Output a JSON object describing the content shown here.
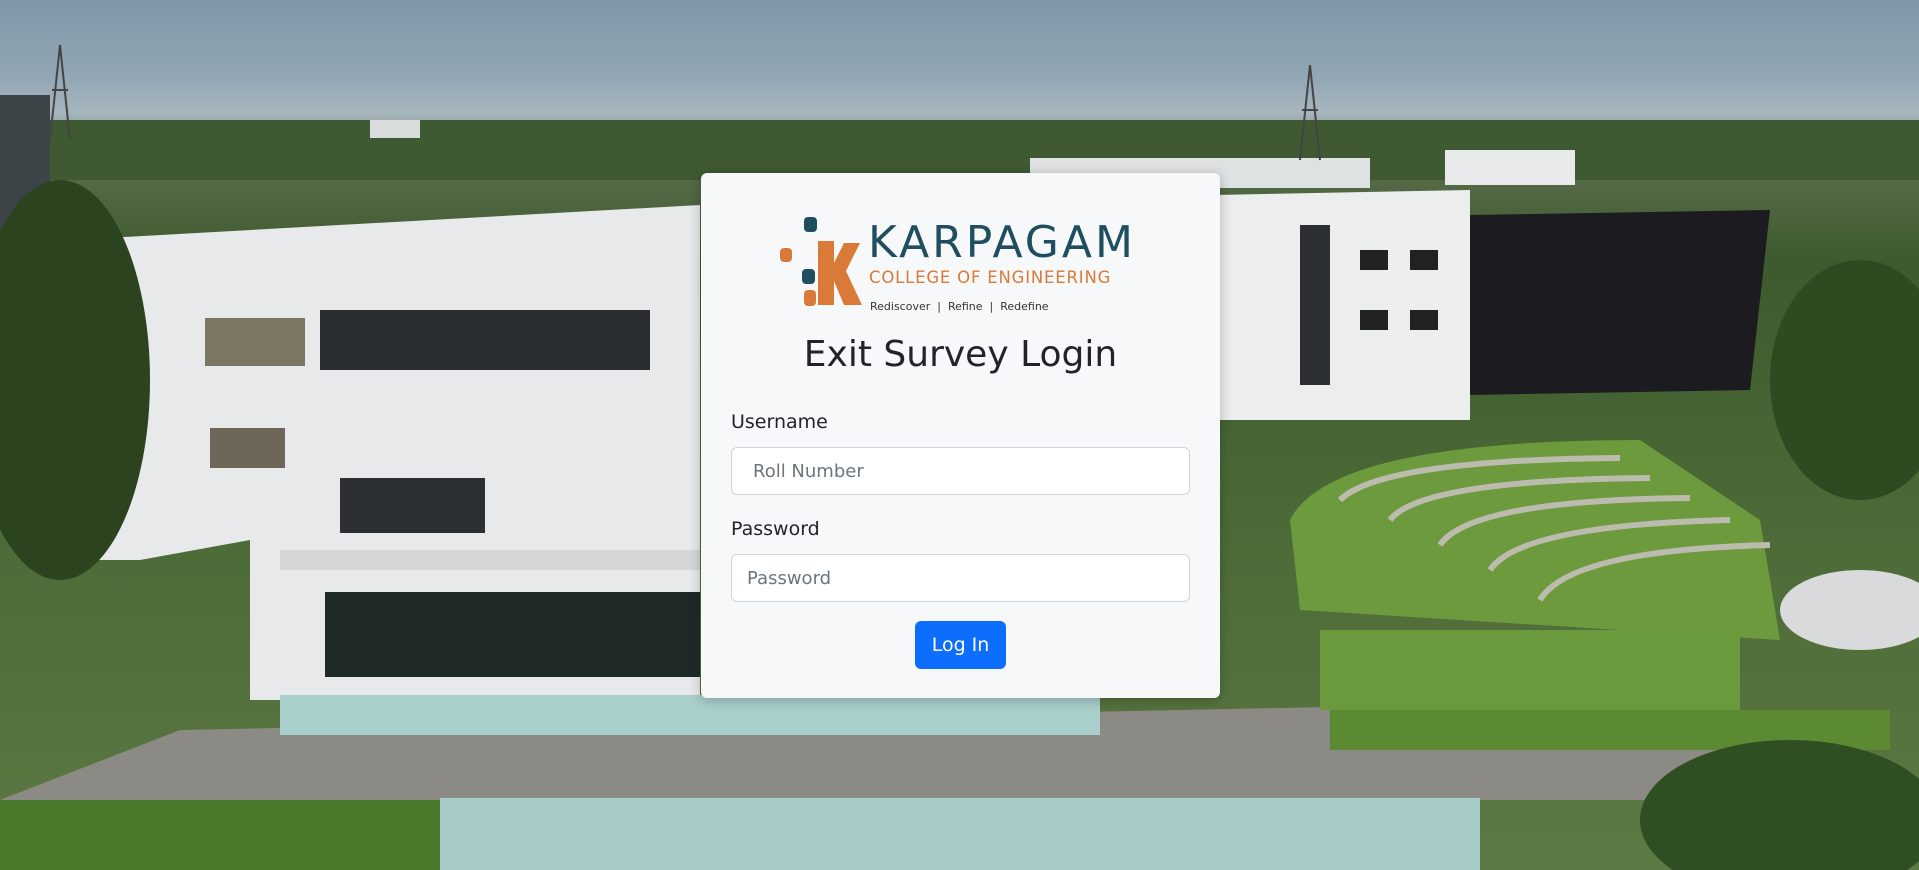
{
  "brand": {
    "name": "KARPAGAM",
    "subtitle": "COLLEGE OF ENGINEERING",
    "tagline": "Rediscover  |  Refine  |  Redefine",
    "colors": {
      "teal": "#1f4e5f",
      "orange": "#d97a38"
    }
  },
  "login": {
    "title": "Exit Survey Login",
    "username_label": "Username",
    "username_placeholder": "Roll Number",
    "password_label": "Password",
    "password_placeholder": "Password",
    "submit_label": "Log In",
    "accent_color": "#0d6efd"
  }
}
